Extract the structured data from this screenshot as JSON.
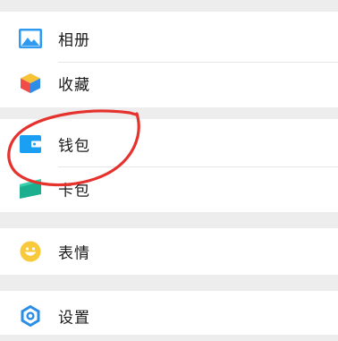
{
  "menu": {
    "items": [
      {
        "label": "相册",
        "icon": "photo-album-icon"
      },
      {
        "label": "收藏",
        "icon": "favorites-cube-icon"
      },
      {
        "label": "钱包",
        "icon": "wallet-icon"
      },
      {
        "label": "卡包",
        "icon": "card-pack-icon"
      },
      {
        "label": "表情",
        "icon": "sticker-smiley-icon"
      },
      {
        "label": "设置",
        "icon": "settings-gear-icon"
      }
    ]
  },
  "annotation": {
    "type": "hand-drawn-circle",
    "color": "#e5322d",
    "target": "钱包"
  },
  "colors": {
    "background": "#ededed",
    "row_bg": "#ffffff",
    "album_icon": "#2f9bf0",
    "wallet_icon": "#1a9ff2",
    "card_pack_icon": "#1bae8f",
    "smiley_icon": "#f8c93a",
    "settings_icon": "#2b8ee6"
  }
}
